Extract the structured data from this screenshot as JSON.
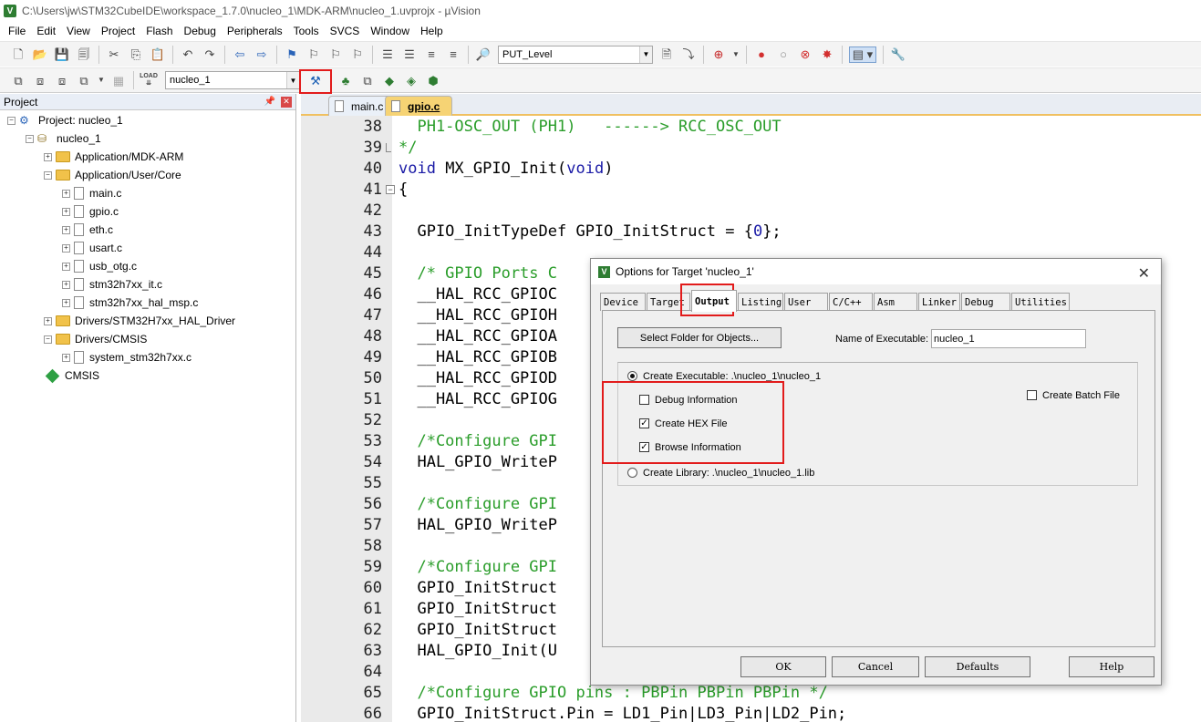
{
  "window": {
    "title": "C:\\Users\\jw\\STM32CubeIDE\\workspace_1.7.0\\nucleo_1\\MDK-ARM\\nucleo_1.uvprojx - µVision"
  },
  "menu": [
    "File",
    "Edit",
    "View",
    "Project",
    "Flash",
    "Debug",
    "Peripherals",
    "Tools",
    "SVCS",
    "Window",
    "Help"
  ],
  "toolbar": {
    "find_combo": "PUT_Level",
    "target_combo": "nucleo_1",
    "load_label": "LOAD"
  },
  "project": {
    "header": "Project",
    "tree": [
      {
        "label": "Project: nucleo_1",
        "level": 0,
        "kind": "project",
        "exp": "-"
      },
      {
        "label": "nucleo_1",
        "level": 1,
        "kind": "target",
        "exp": "-"
      },
      {
        "label": "Application/MDK-ARM",
        "level": 2,
        "kind": "folder",
        "exp": "+"
      },
      {
        "label": "Application/User/Core",
        "level": 2,
        "kind": "folder",
        "exp": "-"
      },
      {
        "label": "main.c",
        "level": 3,
        "kind": "file",
        "exp": "+"
      },
      {
        "label": "gpio.c",
        "level": 3,
        "kind": "file",
        "exp": "+"
      },
      {
        "label": "eth.c",
        "level": 3,
        "kind": "file",
        "exp": "+"
      },
      {
        "label": "usart.c",
        "level": 3,
        "kind": "file",
        "exp": "+"
      },
      {
        "label": "usb_otg.c",
        "level": 3,
        "kind": "file",
        "exp": "+"
      },
      {
        "label": "stm32h7xx_it.c",
        "level": 3,
        "kind": "file",
        "exp": "+"
      },
      {
        "label": "stm32h7xx_hal_msp.c",
        "level": 3,
        "kind": "file",
        "exp": "+"
      },
      {
        "label": "Drivers/STM32H7xx_HAL_Driver",
        "level": 2,
        "kind": "folder",
        "exp": "+"
      },
      {
        "label": "Drivers/CMSIS",
        "level": 2,
        "kind": "folder",
        "exp": "-"
      },
      {
        "label": "system_stm32h7xx.c",
        "level": 3,
        "kind": "file",
        "exp": "+"
      },
      {
        "label": "CMSIS",
        "level": 2,
        "kind": "cmsis",
        "exp": ""
      }
    ]
  },
  "editor": {
    "tabs": [
      {
        "label": "main.c",
        "active": false
      },
      {
        "label": "gpio.c",
        "active": true
      }
    ],
    "lines": [
      {
        "n": "38",
        "t": "  PH1-OSC_OUT (PH1)   ------> RCC_OSC_OUT",
        "c": "green"
      },
      {
        "n": "39",
        "t": "*/",
        "c": "green"
      },
      {
        "n": "40",
        "t": "void MX_GPIO_Init(void)",
        "c": "kw"
      },
      {
        "n": "41",
        "t": "{",
        "c": "plain"
      },
      {
        "n": "42",
        "t": "",
        "c": "plain"
      },
      {
        "n": "43",
        "t": "  GPIO_InitTypeDef GPIO_InitStruct = {0};",
        "c": "plain"
      },
      {
        "n": "44",
        "t": "",
        "c": "plain"
      },
      {
        "n": "45",
        "t": "  /* GPIO Ports C",
        "c": "green"
      },
      {
        "n": "46",
        "t": "  __HAL_RCC_GPIOC",
        "c": "plain"
      },
      {
        "n": "47",
        "t": "  __HAL_RCC_GPIOH",
        "c": "plain"
      },
      {
        "n": "48",
        "t": "  __HAL_RCC_GPIOA",
        "c": "plain"
      },
      {
        "n": "49",
        "t": "  __HAL_RCC_GPIOB",
        "c": "plain"
      },
      {
        "n": "50",
        "t": "  __HAL_RCC_GPIOD",
        "c": "plain"
      },
      {
        "n": "51",
        "t": "  __HAL_RCC_GPIOG",
        "c": "plain"
      },
      {
        "n": "52",
        "t": "",
        "c": "plain"
      },
      {
        "n": "53",
        "t": "  /*Configure GPI",
        "c": "green"
      },
      {
        "n": "54",
        "t": "  HAL_GPIO_WriteP                                             ET);",
        "c": "plain"
      },
      {
        "n": "55",
        "t": "",
        "c": "plain"
      },
      {
        "n": "56",
        "t": "  /*Configure GPI",
        "c": "green"
      },
      {
        "n": "57",
        "t": "  HAL_GPIO_WriteP                                             On_P",
        "c": "plain"
      },
      {
        "n": "58",
        "t": "",
        "c": "plain"
      },
      {
        "n": "59",
        "t": "  /*Configure GPI",
        "c": "green"
      },
      {
        "n": "60",
        "t": "  GPIO_InitStruct",
        "c": "plain"
      },
      {
        "n": "61",
        "t": "  GPIO_InitStruct",
        "c": "plain"
      },
      {
        "n": "62",
        "t": "  GPIO_InitStruct",
        "c": "plain"
      },
      {
        "n": "63",
        "t": "  HAL_GPIO_Init(U",
        "c": "plain"
      },
      {
        "n": "64",
        "t": "",
        "c": "plain"
      },
      {
        "n": "65",
        "t": "  /*Configure GPIO pins : PBPin PBPin PBPin */",
        "c": "green"
      },
      {
        "n": "66",
        "t": "  GPIO_InitStruct.Pin = LD1_Pin|LD3_Pin|LD2_Pin;",
        "c": "plain"
      }
    ]
  },
  "dialog": {
    "title": "Options for Target 'nucleo_1'",
    "tabs": [
      "Device",
      "Target",
      "Output",
      "Listing",
      "User",
      "C/C++",
      "Asm",
      "Linker",
      "Debug",
      "Utilities"
    ],
    "active_tab": "Output",
    "select_folder_label": "Select Folder for Objects...",
    "name_exe_label": "Name of Executable:",
    "name_exe_value": "nucleo_1",
    "create_exe_label": "Create Executable:  .\\nucleo_1\\nucleo_1",
    "debug_info_label": "Debug Information",
    "debug_info_checked": false,
    "create_hex_label": "Create HEX File",
    "create_hex_checked": true,
    "browse_info_label": "Browse Information",
    "browse_info_checked": true,
    "create_batch_label": "Create Batch File",
    "create_batch_checked": false,
    "create_lib_label": "Create Library:  .\\nucleo_1\\nucleo_1.lib",
    "buttons": {
      "ok": "OK",
      "cancel": "Cancel",
      "defaults": "Defaults",
      "help": "Help"
    }
  },
  "colors": {
    "highlight": "#e21b1b",
    "comment": "#2a9d2a",
    "keyword": "#1a1aa6",
    "tab_accent": "#f0c060"
  }
}
